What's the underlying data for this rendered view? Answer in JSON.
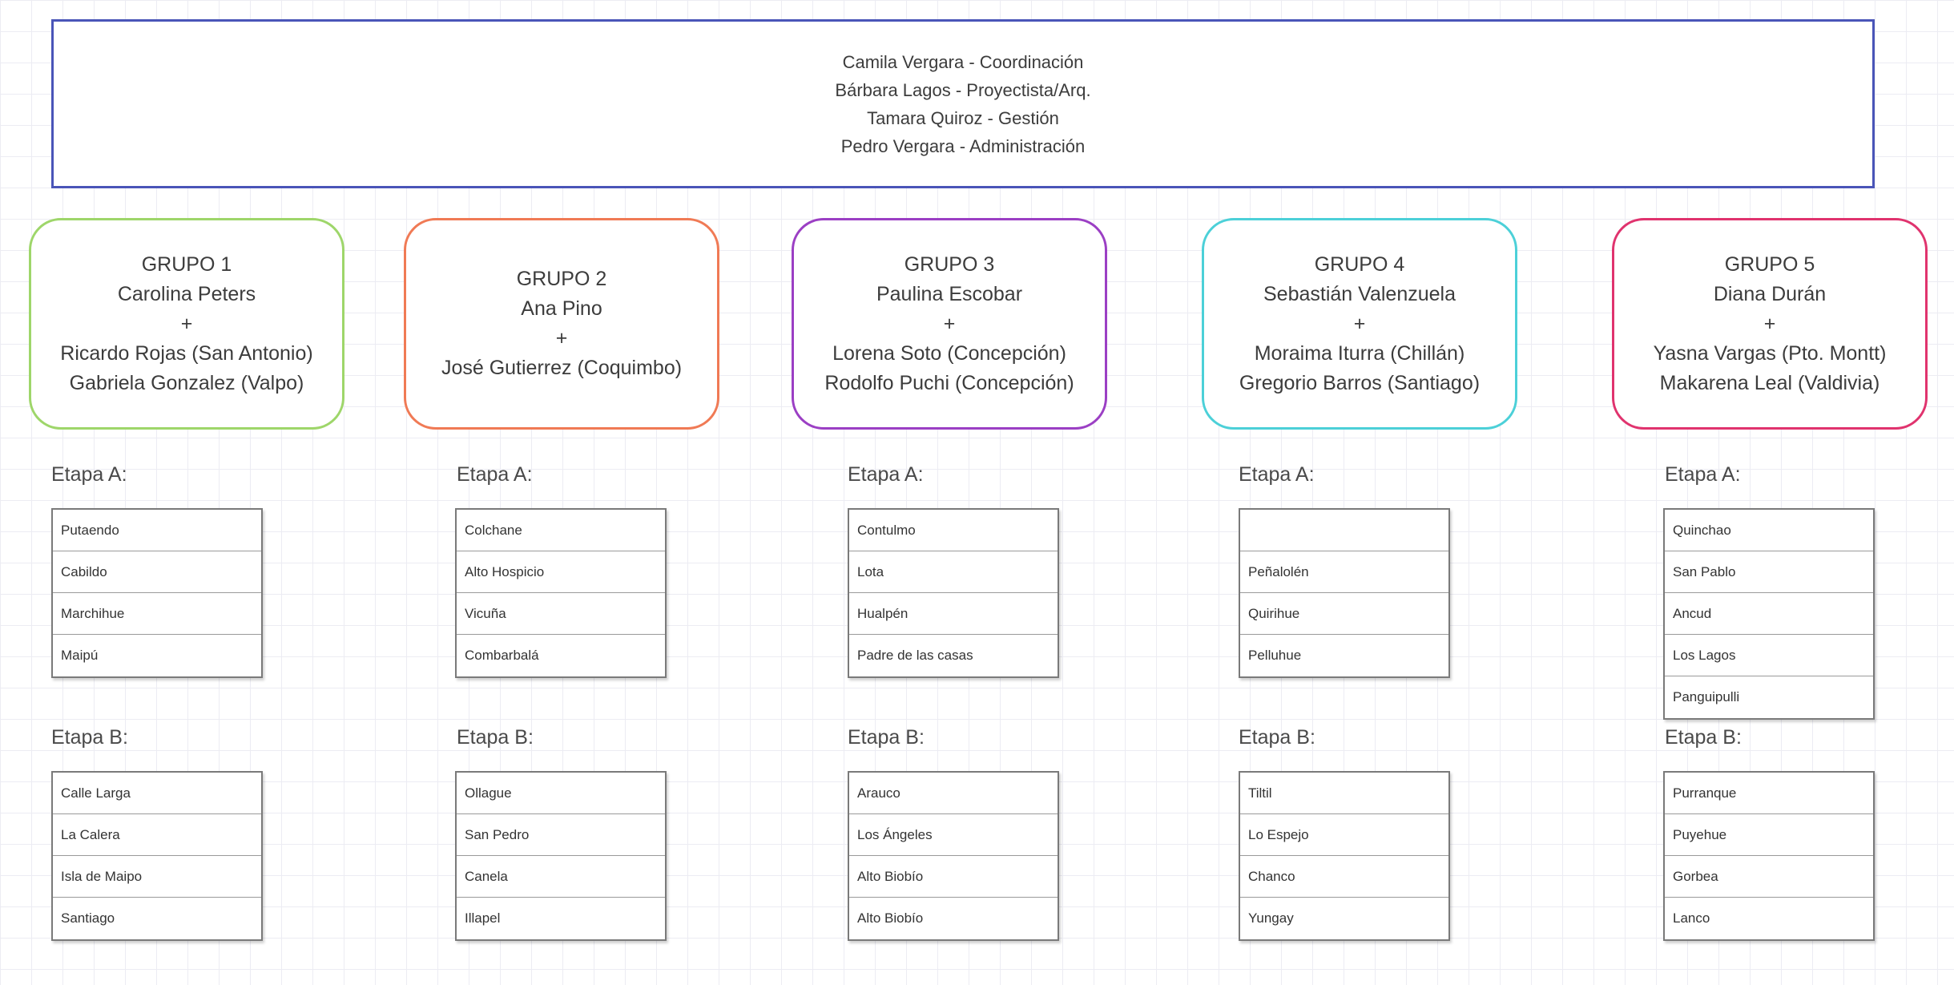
{
  "coordination": [
    "Camila Vergara - Coordinación",
    "Bárbara Lagos - Proyectista/Arq.",
    "Tamara Quiroz - Gestión",
    "Pedro Vergara - Administración"
  ],
  "stage_a_label": "Etapa A:",
  "stage_b_label": "Etapa B:",
  "groups": [
    {
      "color": "#9ed66a",
      "lines": [
        "GRUPO 1",
        "Carolina Peters",
        "+",
        "Ricardo Rojas (San Antonio)",
        "Gabriela Gonzalez (Valpo)"
      ],
      "stage_a": [
        "Putaendo",
        "Cabildo",
        "Marchihue",
        "Maipú"
      ],
      "stage_b": [
        "Calle Larga",
        "La Calera",
        "Isla de Maipo",
        "Santiago"
      ]
    },
    {
      "color": "#f07a55",
      "lines": [
        "GRUPO 2",
        "Ana Pino",
        "+",
        "José Gutierrez (Coquimbo)"
      ],
      "stage_a": [
        "Colchane",
        "Alto Hospicio",
        "Vicuña",
        "Combarbalá"
      ],
      "stage_b": [
        "Ollague",
        "San Pedro",
        "Canela",
        "Illapel"
      ]
    },
    {
      "color": "#9b3fc4",
      "lines": [
        "GRUPO 3",
        "Paulina Escobar",
        "+",
        "Lorena Soto (Concepción)",
        "Rodolfo Puchi (Concepción)"
      ],
      "stage_a": [
        "Contulmo",
        "Lota",
        "Hualpén",
        "Padre de las casas"
      ],
      "stage_b": [
        "Arauco",
        "Los Ángeles",
        "Alto Biobío",
        "Alto Biobío"
      ]
    },
    {
      "color": "#4cd0d8",
      "lines": [
        "GRUPO 4",
        "Sebastián Valenzuela",
        "+",
        "Moraima Iturra (Chillán)",
        "Gregorio Barros (Santiago)"
      ],
      "stage_a": [
        "",
        "Peñalolén",
        "Quirihue",
        "Pelluhue"
      ],
      "stage_b": [
        "Tiltil",
        "Lo Espejo",
        "Chanco",
        "Yungay"
      ]
    },
    {
      "color": "#e0336e",
      "lines": [
        "GRUPO 5",
        "Diana Durán",
        "+",
        "Yasna Vargas (Pto. Montt)",
        "Makarena Leal (Valdivia)"
      ],
      "stage_a": [
        "Quinchao",
        "San Pablo",
        "Ancud",
        "Los Lagos",
        "Panguipulli"
      ],
      "stage_b": [
        "Purranque",
        "Puyehue",
        "Gorbea",
        "Lanco"
      ]
    }
  ]
}
